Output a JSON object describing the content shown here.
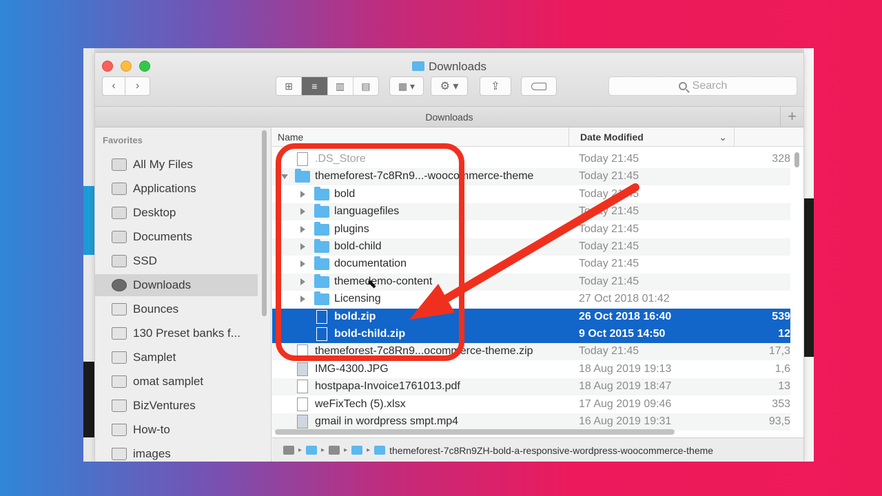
{
  "window": {
    "title": "Downloads",
    "path_title": "Downloads"
  },
  "toolbar": {
    "back": "‹",
    "forward": "›",
    "views": [
      "⊞",
      "≡",
      "▥",
      "▤"
    ],
    "arrange": "▦ ▾",
    "action": "⚙ ▾",
    "share": "⇪",
    "search_placeholder": "Search"
  },
  "sidebar": {
    "heading": "Favorites",
    "items": [
      {
        "label": "All My Files",
        "icon": "all-files-icon"
      },
      {
        "label": "Applications",
        "icon": "applications-icon"
      },
      {
        "label": "Desktop",
        "icon": "desktop-icon"
      },
      {
        "label": "Documents",
        "icon": "documents-icon"
      },
      {
        "label": "SSD",
        "icon": "disk-icon"
      },
      {
        "label": "Downloads",
        "icon": "downloads-icon",
        "selected": true
      },
      {
        "label": "Bounces",
        "icon": "folder-icon"
      },
      {
        "label": "130 Preset banks f...",
        "icon": "folder-icon"
      },
      {
        "label": "Samplet",
        "icon": "folder-icon"
      },
      {
        "label": "omat samplet",
        "icon": "folder-icon"
      },
      {
        "label": "BizVentures",
        "icon": "folder-icon"
      },
      {
        "label": "How-to",
        "icon": "folder-icon"
      },
      {
        "label": "images",
        "icon": "folder-icon"
      }
    ]
  },
  "columns": {
    "name": "Name",
    "date": "Date Modified",
    "sort_icon": "⌄"
  },
  "files": [
    {
      "name": ".DS_Store",
      "date": "Today 21:45",
      "size": "328",
      "kind": "doc",
      "depth": 0,
      "dim": true
    },
    {
      "name": "themeforest-7c8Rn9...-woocommerce-theme",
      "date": "Today 21:45",
      "size": "",
      "kind": "folder",
      "depth": 0,
      "expanded": true
    },
    {
      "name": "bold",
      "date": "Today 21:45",
      "size": "",
      "kind": "folder",
      "depth": 1
    },
    {
      "name": "languagefiles",
      "date": "Today 21:45",
      "size": "",
      "kind": "folder",
      "depth": 1
    },
    {
      "name": "plugins",
      "date": "Today 21:45",
      "size": "",
      "kind": "folder",
      "depth": 1
    },
    {
      "name": "bold-child",
      "date": "Today 21:45",
      "size": "",
      "kind": "folder",
      "depth": 1
    },
    {
      "name": "documentation",
      "date": "Today 21:45",
      "size": "",
      "kind": "folder",
      "depth": 1
    },
    {
      "name": "themedemo-content",
      "date": "Today 21:45",
      "size": "",
      "kind": "folder",
      "depth": 1
    },
    {
      "name": "Licensing",
      "date": "27 Oct 2018 01:42",
      "size": "",
      "kind": "folder",
      "depth": 1
    },
    {
      "name": "bold.zip",
      "date": "26 Oct 2018 16:40",
      "size": "539",
      "kind": "doc",
      "depth": 1,
      "selected": true
    },
    {
      "name": "bold-child.zip",
      "date": "9 Oct 2015 14:50",
      "size": "12",
      "kind": "doc",
      "depth": 1,
      "selected": true
    },
    {
      "name": "themeforest-7c8Rn9...ocommerce-theme.zip",
      "date": "Today 21:45",
      "size": "17,3",
      "kind": "doc",
      "depth": 0
    },
    {
      "name": "IMG-4300.JPG",
      "date": "18 Aug 2019 19:13",
      "size": "1,6",
      "kind": "img",
      "depth": 0
    },
    {
      "name": "hostpapa-Invoice1761013.pdf",
      "date": "18 Aug 2019 18:47",
      "size": "13",
      "kind": "doc",
      "depth": 0
    },
    {
      "name": "weFixTech (5).xlsx",
      "date": "17 Aug 2019 09:46",
      "size": "353",
      "kind": "doc",
      "depth": 0
    },
    {
      "name": "gmail in wordpress smpt.mp4",
      "date": "16 Aug 2019 19:31",
      "size": "93,5",
      "kind": "img",
      "depth": 0
    }
  ],
  "path_bar": {
    "separator": "▸",
    "final": "themeforest-7c8Rn9ZH-bold-a-responsive-wordpress-woocommerce-theme"
  },
  "annotation": {
    "box_color": "#f0301e",
    "arrow_color": "#f0301e"
  },
  "pathbar_plus": "+"
}
